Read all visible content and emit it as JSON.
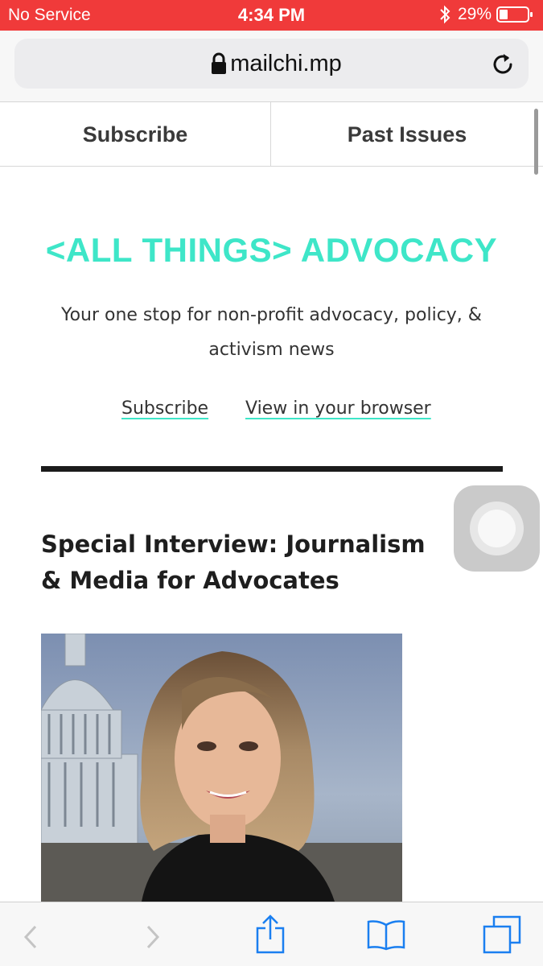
{
  "status_bar": {
    "carrier": "No Service",
    "time": "4:34 PM",
    "battery": "29%",
    "background_color": "#f03a3a"
  },
  "browser": {
    "url": "mailchi.mp",
    "lock_icon": "lock-icon",
    "reload_icon": "reload-icon"
  },
  "page_nav": {
    "subscribe": "Subscribe",
    "past_issues": "Past Issues"
  },
  "newsletter": {
    "title": "<ALL THINGS> ADVOCACY",
    "title_color": "#3ee6c8",
    "tagline": "Your one stop for non-profit advocacy, policy, & activism news",
    "subscribe_link": "Subscribe",
    "view_browser_link": "View in your browser",
    "article_title": "Special Interview: Journalism & Media for Advocates"
  },
  "toolbar": {
    "icons": [
      "back-icon",
      "forward-icon",
      "share-icon",
      "bookmarks-icon",
      "tabs-icon"
    ],
    "accent_color": "#1a7ff0"
  }
}
